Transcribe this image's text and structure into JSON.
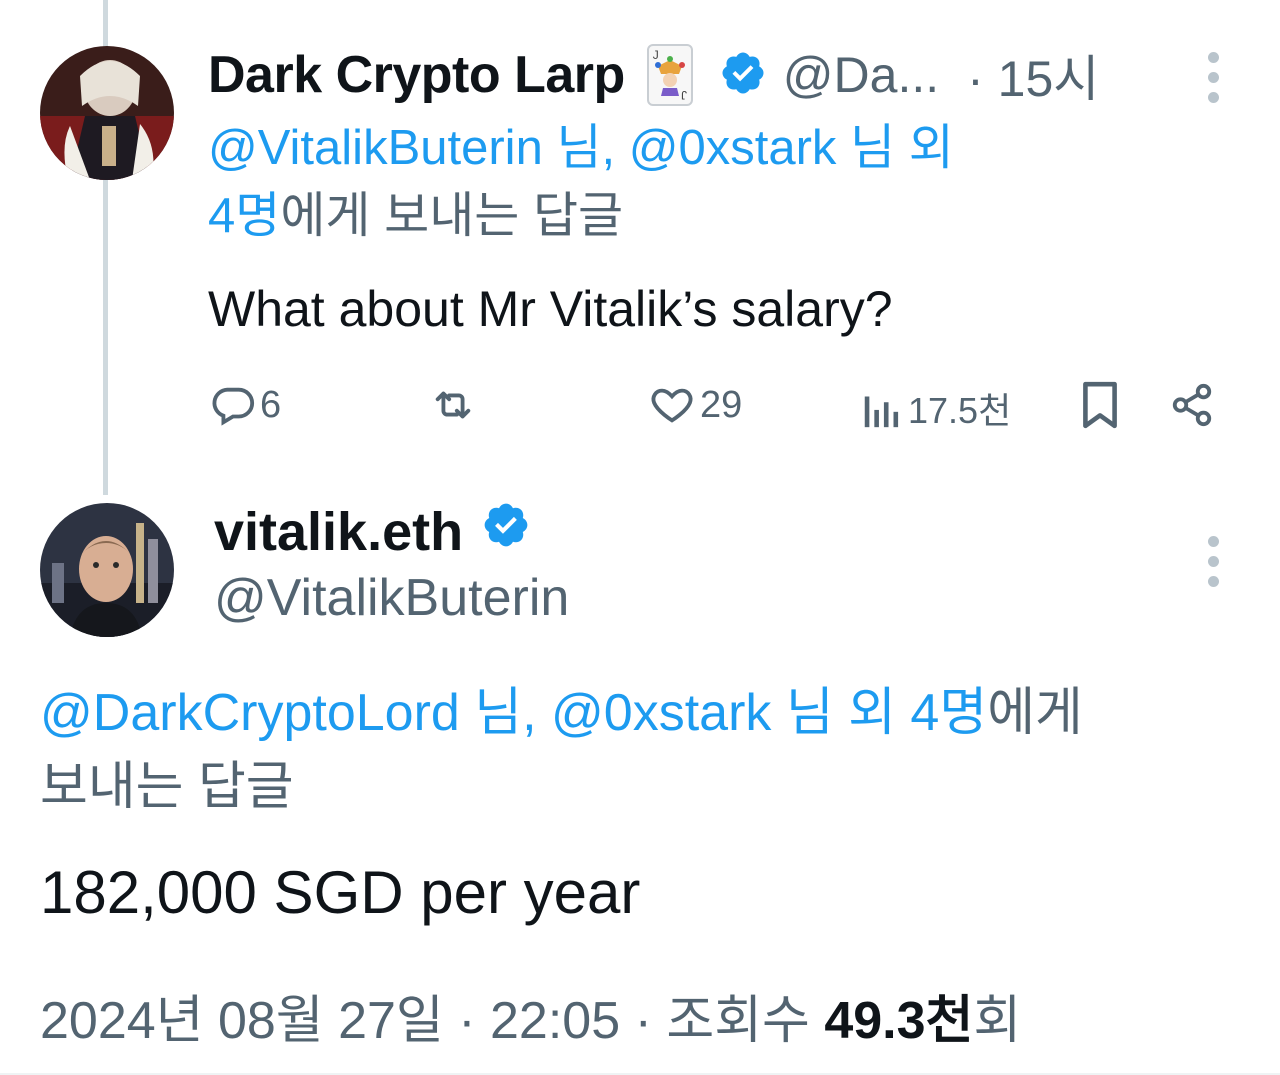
{
  "reply_tweet": {
    "author_name": "Dark Crypto Larp",
    "author_handle": "@Da...",
    "time": "· 15시",
    "emoji_card": "joker-card-emoji",
    "reply_to": {
      "mention1": "@VitalikButerin",
      "sep1": " 님, ",
      "mention2": "@0xstark",
      "sep2": " 님 외",
      "mention3": "4명",
      "suffix": "에게 보내는 답글"
    },
    "text": "What about Mr Vitalik’s salary?",
    "stats": {
      "replies": "6",
      "retweets": "",
      "likes": "29",
      "views": "17.5천"
    },
    "icons": [
      "reply-icon",
      "retweet-icon",
      "like-icon",
      "views-icon",
      "bookmark-icon",
      "share-icon"
    ]
  },
  "main_tweet": {
    "author_name": "vitalik.eth",
    "author_handle": "@VitalikButerin",
    "reply_to": {
      "mention1": "@DarkCryptoLord",
      "sep1": " 님, ",
      "mention2": "@0xstark",
      "sep2": " 님 외 ",
      "mention3": "4명",
      "suffix1": "에게",
      "suffix2": "보내는 답글"
    },
    "text": "182,000 SGD per year",
    "meta": {
      "date": "2024년 08월 27일",
      "sep1": " · ",
      "time": "22:05",
      "sep2": " · ",
      "views_label": "조회수 ",
      "views_count": "49.3천",
      "views_suffix": "회"
    }
  },
  "colors": {
    "link": "#1d9bf0",
    "secondary_text": "#536471",
    "primary_text": "#0f1419",
    "verified_badge": "#1d9bf0",
    "thread_line": "#cfd9de"
  }
}
